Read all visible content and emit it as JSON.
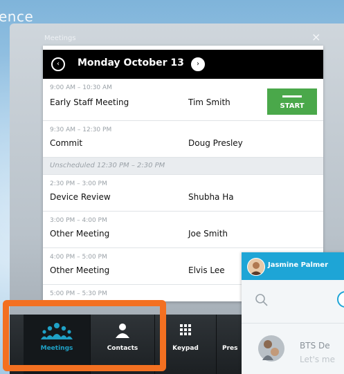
{
  "brand_text": "ence",
  "meetings_window": {
    "title": "Meetings",
    "close_glyph": "×",
    "date_label": "Monday October 13",
    "prev_glyph": "‹",
    "next_glyph": "›",
    "start_label": "START",
    "unscheduled_label": "Unscheduled 12:30 PM – 2:30 PM",
    "meetings": [
      {
        "time": "9:00 AM – 10:30 AM",
        "title": "Early Staff Meeting",
        "host": "Tim Smith"
      },
      {
        "time": "9:30 AM – 12:30 PM",
        "title": "Commit",
        "host": "Doug Presley"
      },
      {
        "time": "2:30 PM – 3:00 PM",
        "title": "Device Review",
        "host": "Shubha Ha"
      },
      {
        "time": "3:00 PM – 4:00 PM",
        "title": "Other Meeting",
        "host": "Joe Smith"
      },
      {
        "time": "4:00 PM – 5:00 PM",
        "title": "Other Meeting",
        "host": "Elvis Lee"
      },
      {
        "time": "5:00 PM – 5:30 PM",
        "title": "",
        "host": ""
      }
    ]
  },
  "bottom_tabs": [
    {
      "label": "Meetings",
      "icon": "meetings-icon",
      "active": true
    },
    {
      "label": "Contacts",
      "icon": "contact-icon",
      "active": false
    },
    {
      "label": "Keypad",
      "icon": "keypad-icon",
      "active": false
    },
    {
      "label": "Pres",
      "icon": "presentation-icon",
      "active": false
    }
  ],
  "chat": {
    "user_name": "Jasmine Palmer",
    "item_title": "BTS De",
    "item_preview": "Let's me"
  },
  "colors": {
    "start_green": "#4aa84a",
    "highlight_orange": "#f37021",
    "chat_blue": "#1ea5d6",
    "active_tab_blue": "#1fa1c6"
  }
}
